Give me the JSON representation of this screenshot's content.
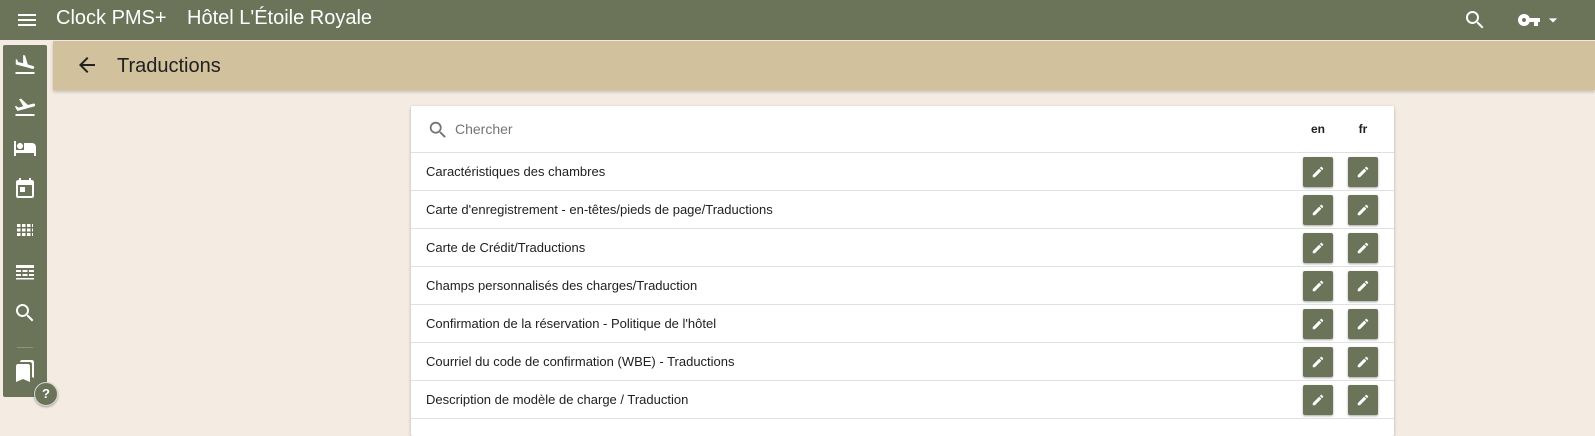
{
  "app": {
    "name": "Clock PMS+",
    "hotel": "Hôtel L'Étoile Royale"
  },
  "header": {
    "title": "Traductions"
  },
  "search": {
    "placeholder": "Chercher",
    "value": ""
  },
  "columns": {
    "en": "en",
    "fr": "fr"
  },
  "rows": [
    {
      "label": "Caractéristiques des chambres"
    },
    {
      "label": "Carte d'enregistrement - en-têtes/pieds de page/Traductions"
    },
    {
      "label": "Carte de Crédit/Traductions"
    },
    {
      "label": "Champs personnalisés des charges/Traduction"
    },
    {
      "label": "Confirmation de la réservation - Politique de l'hôtel"
    },
    {
      "label": "Courriel du code de confirmation (WBE) - Traductions"
    },
    {
      "label": "Description de modèle de charge / Traduction"
    }
  ],
  "sidebar": {
    "items": [
      {
        "icon": "flight-land-icon"
      },
      {
        "icon": "flight-takeoff-icon"
      },
      {
        "icon": "hotel-bed-icon"
      },
      {
        "icon": "calendar-icon"
      },
      {
        "icon": "grid-icon"
      },
      {
        "icon": "table-icon"
      },
      {
        "icon": "search-icon"
      },
      {
        "icon": "bookmarks-icon"
      }
    ],
    "help": "?"
  },
  "colors": {
    "primary": "#6b7358",
    "header": "#d1c19c",
    "background": "#f4ece2"
  }
}
